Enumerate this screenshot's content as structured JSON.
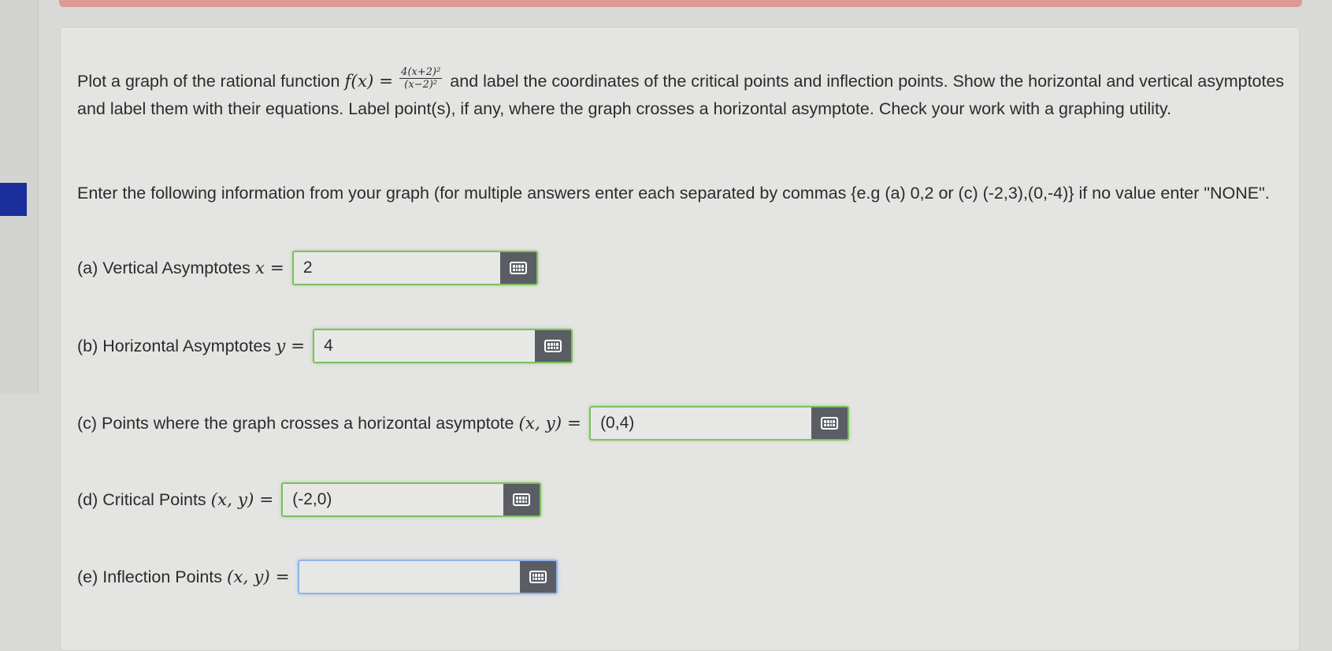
{
  "problem": {
    "intro": "Plot a graph of the rational function",
    "function_lhs": "f(x) =",
    "numerator": "4(x+2)²",
    "denominator": "(x−2)²",
    "instructions": "and label the coordinates of the critical points and inflection points. Show the horizontal and vertical asymptotes and label them with their equations. Label point(s), if any, where the graph crosses a horizontal asymptote. Check your work with a graphing utility.",
    "entry_instructions": "Enter the following information from your graph (for multiple answers enter each separated by commas {e.g (a) 0,2 or (c) (-2,3),(0,-4)} if no value enter \"NONE\"."
  },
  "questions": [
    {
      "label_text": "(a) Vertical Asymptotes",
      "math": "x =",
      "value": "2"
    },
    {
      "label_text": "(b) Horizontal Asymptotes",
      "math": "y =",
      "value": "4"
    },
    {
      "label_text": "(c) Points where the graph crosses a horizontal asymptote",
      "math": "(x, y) =",
      "value": "(0,4)"
    },
    {
      "label_text": "(d) Critical Points",
      "math": "(x, y) =",
      "value": "(-2,0)"
    },
    {
      "label_text": "(e) Inflection Points",
      "math": "(x, y) =",
      "value": ""
    }
  ],
  "icons": {
    "keypad": "keypad-icon"
  },
  "colors": {
    "accent_bar": "#df9a96",
    "sidebar_accent": "#1b2e9c",
    "correct_border": "#7cbf5e",
    "focus_border": "#8fb3e8",
    "keypad_button": "#5a5d63"
  }
}
